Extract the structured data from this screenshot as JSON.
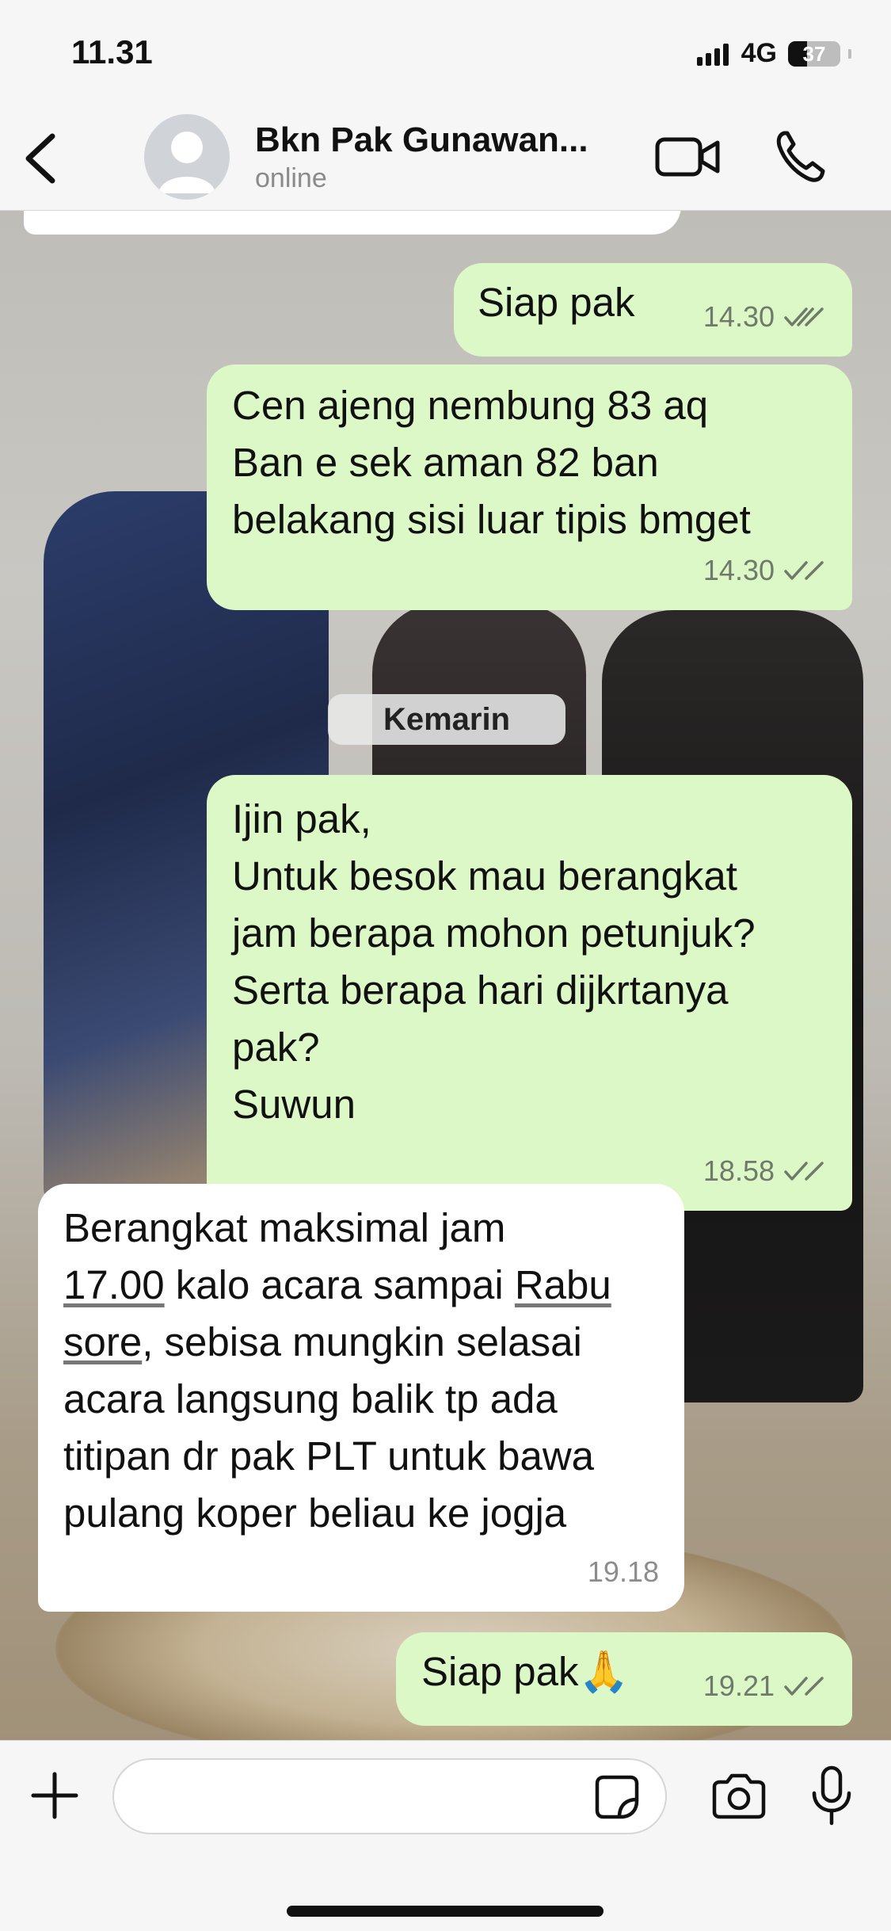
{
  "status_bar": {
    "time": "11.31",
    "network": "4G",
    "battery": "37",
    "battery_level": 0.37
  },
  "header": {
    "back_icon": "chevron-left-icon",
    "contact_name": "Bkn Pak Gunawan...",
    "contact_status": "online",
    "video_icon": "video-camera-icon",
    "call_icon": "phone-icon"
  },
  "messages": [
    {
      "direction": "out",
      "text": "Siap pak",
      "time": "14.30",
      "read": true
    },
    {
      "direction": "out",
      "text": "Cen ajeng nembung 83 aq\nBan e sek aman 82 ban\nbelakang sisi luar tipis bmget",
      "time": "14.30",
      "read": true
    },
    {
      "direction": "out",
      "text": "Ijin pak,\nUntuk besok mau berangkat\njam berapa mohon petunjuk?\nSerta berapa hari dijkrtanya\npak?\nSuwun",
      "time": "18.58",
      "read": true
    },
    {
      "direction": "in",
      "text_parts": [
        "Berangkat maksimal jam\n",
        "17.00",
        " kalo acara sampai ",
        "Rabu\nsore",
        ", sebisa mungkin selasai\nacara langsung balik tp ada\ntitipan dr pak PLT untuk bawa\npulang koper beliau ke jogja"
      ],
      "time": "19.18"
    },
    {
      "direction": "out",
      "text": "Siap pak🙏",
      "time": "19.21",
      "read": true
    }
  ],
  "date_separator": "Kemarin",
  "input_bar": {
    "plus_icon": "plus-icon",
    "placeholder": "",
    "sticker_icon": "sticker-icon",
    "camera_icon": "camera-icon",
    "mic_icon": "microphone-icon"
  },
  "colors": {
    "outgoing_bubble": "#dbf8c6",
    "incoming_bubble": "#ffffff",
    "read_ticks": "#6f7a6a"
  }
}
